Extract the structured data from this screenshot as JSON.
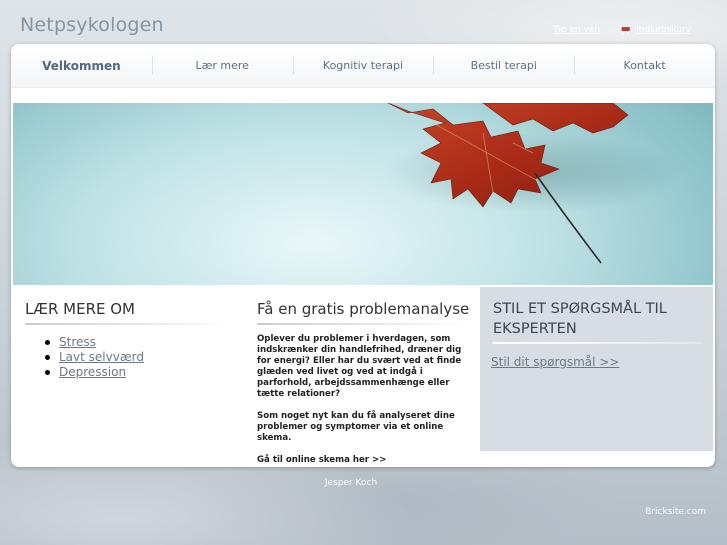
{
  "site": {
    "title": "Netpsykologen"
  },
  "top_links": {
    "tip": "Tip en ven",
    "cart": "Indkøbskurv"
  },
  "nav": {
    "items": [
      {
        "label": "Velkommen",
        "active": true
      },
      {
        "label": "Lær mere",
        "active": false
      },
      {
        "label": "Kognitiv terapi",
        "active": false
      },
      {
        "label": "Bestil terapi",
        "active": false
      },
      {
        "label": "Kontakt",
        "active": false
      }
    ]
  },
  "col1": {
    "heading": "LÆR MERE OM",
    "links": [
      "Stress",
      "Lavt selvværd",
      "Depression"
    ]
  },
  "col2": {
    "heading": "Få en gratis problemanalyse",
    "paragraphs": [
      "Oplever du problemer i hverdagen, som indskrænker din handlefrihed, dræner dig for energi? Eller har du svært ved at finde glæden ved livet og ved at indgå i parforhold, arbejdssammenhænge eller tætte relationer?",
      "Som noget nyt kan du få analyseret dine problemer og symptomer via et online skema.",
      "Gå til online skema her >>"
    ]
  },
  "col3": {
    "heading": "STIL ET SPØRGSMÅL TIL EKSPERTEN",
    "link": "Stil dit spørgsmål >>"
  },
  "footer": {
    "name": "Jesper Koch",
    "brand": "Bricksite.com"
  },
  "colors": {
    "accent": "#5a7288",
    "leaf": "#b8321c",
    "sidebar_bg": "#d7dde2"
  },
  "icons": {
    "cart": "shopping-cart-icon"
  }
}
